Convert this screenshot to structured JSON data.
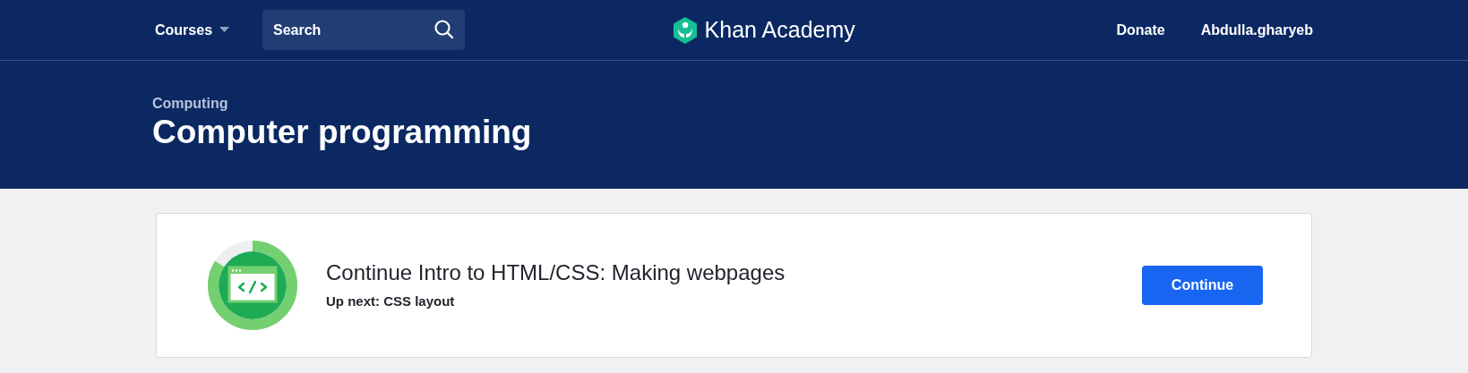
{
  "nav": {
    "courses": "Courses",
    "search": {
      "placeholder": "Search"
    },
    "logo": "Khan Academy",
    "links": [
      "Donate",
      "Abdulla.gharyeb"
    ]
  },
  "header": {
    "subject": "Computing",
    "title": "Computer programming"
  },
  "continue_card": {
    "progress": {
      "level": 0.84
    },
    "title": "Continue Intro to HTML/CSS: Making webpages",
    "subtitle": "Up next: CSS layout",
    "button": "Continue"
  }
}
